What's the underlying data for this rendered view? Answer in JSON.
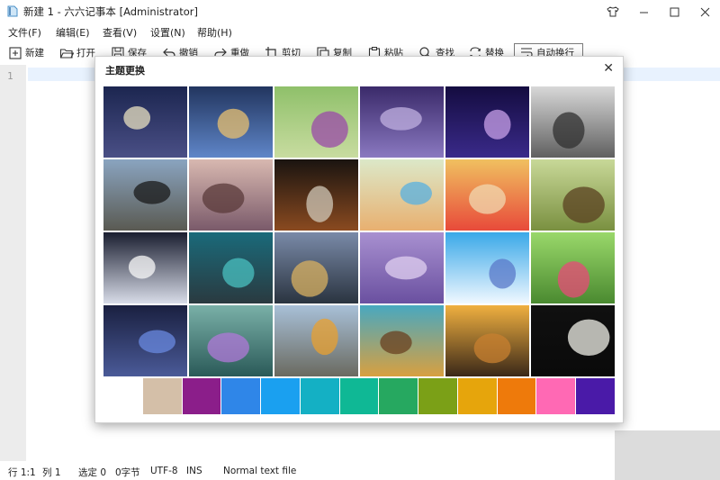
{
  "window": {
    "title": "新建 1 - 六六记事本 [Administrator]",
    "controls": [
      "restore-shirt",
      "minimize",
      "maximize",
      "close"
    ]
  },
  "menu": [
    "文件(F)",
    "编辑(E)",
    "查看(V)",
    "设置(N)",
    "帮助(H)"
  ],
  "toolbar": [
    {
      "label": "新建",
      "icon": "new-file-icon"
    },
    {
      "label": "打开",
      "icon": "folder-open-icon"
    },
    {
      "label": "保存",
      "icon": "save-icon"
    },
    {
      "label": "撤销",
      "icon": "undo-icon"
    },
    {
      "label": "重做",
      "icon": "redo-icon"
    },
    {
      "label": "剪切",
      "icon": "cut-icon"
    },
    {
      "label": "复制",
      "icon": "copy-icon"
    },
    {
      "label": "粘贴",
      "icon": "paste-icon"
    },
    {
      "label": "查找",
      "icon": "search-icon"
    },
    {
      "label": "替换",
      "icon": "replace-icon"
    },
    {
      "label": "自动换行",
      "icon": "wrap-icon",
      "active": true
    }
  ],
  "editor": {
    "line_number": "1"
  },
  "dialog": {
    "title": "主题更换",
    "close_glyph": "✕",
    "themes": [
      {
        "name": "starry-night-sky",
        "top": "#1c2650",
        "bottom": "#4a4f86",
        "accent": "#e8e0c0"
      },
      {
        "name": "anime-knight-blue",
        "top": "#22355f",
        "bottom": "#5f86c8",
        "accent": "#e8c070"
      },
      {
        "name": "purple-flowers-green",
        "top": "#8fc06a",
        "bottom": "#c8dca0",
        "accent": "#9a4aa8"
      },
      {
        "name": "purple-sea-sunset",
        "top": "#3a2a6a",
        "bottom": "#8a78c0",
        "accent": "#c0b0e0"
      },
      {
        "name": "anime-girl-purple",
        "top": "#140c40",
        "bottom": "#3a2a8a",
        "accent": "#c8a0e8"
      },
      {
        "name": "bw-pier",
        "top": "#d8d8d8",
        "bottom": "#606060",
        "accent": "#303030"
      },
      {
        "name": "motorcycle-road",
        "top": "#8aa4c0",
        "bottom": "#5a5a52",
        "accent": "#1a1a1a"
      },
      {
        "name": "eiffel-tower",
        "top": "#d8b8b0",
        "bottom": "#7a5a6a",
        "accent": "#5a3a3a"
      },
      {
        "name": "vintage-camera",
        "top": "#1a1410",
        "bottom": "#8a4a20",
        "accent": "#d0c8b8"
      },
      {
        "name": "girl-with-balloons",
        "top": "#dce8c8",
        "bottom": "#e8b070",
        "accent": "#58b0e0"
      },
      {
        "name": "red-dress-girl",
        "top": "#f0c060",
        "bottom": "#e84a3a",
        "accent": "#f0d8b0"
      },
      {
        "name": "toy-frog-green",
        "top": "#c8d898",
        "bottom": "#7a9040",
        "accent": "#5a4020"
      },
      {
        "name": "snow-toy-figure",
        "top": "#1a1e30",
        "bottom": "#d8dce8",
        "accent": "#f8f8f8"
      },
      {
        "name": "teal-bokeh",
        "top": "#1a6a7a",
        "bottom": "#2a3a40",
        "accent": "#4ac0c0"
      },
      {
        "name": "cardboard-robot",
        "top": "#7a8aa8",
        "bottom": "#2a3440",
        "accent": "#d8b060"
      },
      {
        "name": "wisteria",
        "top": "#a890d0",
        "bottom": "#6a50a0",
        "accent": "#e0d0f0"
      },
      {
        "name": "anime-girl-sky",
        "top": "#3aa8e8",
        "bottom": "#f0f8ff",
        "accent": "#5a78c8"
      },
      {
        "name": "pink-flower",
        "top": "#9ad86a",
        "bottom": "#4a8a30",
        "accent": "#e84a78"
      },
      {
        "name": "blue-butterfly",
        "top": "#1a2040",
        "bottom": "#4a5a98",
        "accent": "#6a8ae0"
      },
      {
        "name": "purple-blossom-bokeh",
        "top": "#7ab0a8",
        "bottom": "#2a5a58",
        "accent": "#b078d8"
      },
      {
        "name": "mountain-balloon",
        "top": "#a8c0d8",
        "bottom": "#6a6a60",
        "accent": "#e8a030"
      },
      {
        "name": "desert-car",
        "top": "#48a8c0",
        "bottom": "#d8a040",
        "accent": "#6a4020"
      },
      {
        "name": "sunset-grass",
        "top": "#f0b040",
        "bottom": "#3a2818",
        "accent": "#c88030"
      },
      {
        "name": "cat-moon",
        "top": "#101010",
        "bottom": "#0a0a0a",
        "accent": "#f0f0e8"
      }
    ],
    "swatches": [
      "#ffffff",
      "#d4bfa8",
      "#8b1e8a",
      "#2f86e8",
      "#1aa0f0",
      "#14b0c4",
      "#0fb895",
      "#26a860",
      "#7ba017",
      "#e6a50c",
      "#ee7a0b",
      "#ff69b4",
      "#4a1aa8"
    ]
  },
  "status": {
    "position": "行 1:1",
    "column": "列 1",
    "selected": "选定 0",
    "bytes": "0字节",
    "encoding": "UTF-8",
    "mode": "INS",
    "filetype": "Normal text file"
  }
}
